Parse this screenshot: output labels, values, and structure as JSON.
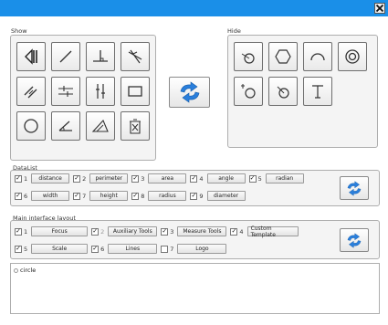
{
  "window": {
    "close_icon": "close-x-icon"
  },
  "show": {
    "label": "Show",
    "tools": [
      {
        "icon": "intersection-point-icon"
      },
      {
        "icon": "line-segment-icon"
      },
      {
        "icon": "perpendicular-icon"
      },
      {
        "icon": "angle-bisector-icon"
      },
      {
        "icon": "parallel-lines-icon"
      },
      {
        "icon": "equal-marks-icon"
      },
      {
        "icon": "vertical-bars-icon"
      },
      {
        "icon": "rectangle-icon"
      },
      {
        "icon": "circle-icon"
      },
      {
        "icon": "angle-icon"
      },
      {
        "icon": "triangle-icon"
      },
      {
        "icon": "delete-icon"
      }
    ]
  },
  "hide": {
    "label": "Hide",
    "tools": [
      {
        "icon": "circle-point-icon"
      },
      {
        "icon": "hexagon-icon"
      },
      {
        "icon": "arc-icon"
      },
      {
        "icon": "concentric-circle-icon"
      },
      {
        "icon": "tangent-circle-icon"
      },
      {
        "icon": "circle-line-icon"
      },
      {
        "icon": "text-icon"
      }
    ]
  },
  "swap_icon": "swap-arrows-icon",
  "datalist": {
    "label": "DataList",
    "items": [
      {
        "num": "1",
        "label": "distance"
      },
      {
        "num": "2",
        "label": "perimeter"
      },
      {
        "num": "3",
        "label": "area"
      },
      {
        "num": "4",
        "label": "angle"
      },
      {
        "num": "5",
        "label": "radian"
      },
      {
        "num": "6",
        "label": "width"
      },
      {
        "num": "7",
        "label": "height"
      },
      {
        "num": "8",
        "label": "radius"
      },
      {
        "num": "9",
        "label": "diameter"
      }
    ]
  },
  "layout": {
    "label": "Main interface layout",
    "items": [
      {
        "num": "1",
        "label": "Focus",
        "checked": true
      },
      {
        "num": "2",
        "label": "Auxiliary Tools",
        "checked": true
      },
      {
        "num": "3",
        "label": "Measure Tools",
        "checked": true
      },
      {
        "num": "4",
        "label": "Custom Template",
        "checked": true
      },
      {
        "num": "5",
        "label": "Scale",
        "checked": true
      },
      {
        "num": "6",
        "label": "Lines",
        "checked": true
      },
      {
        "num": "7",
        "label": "Logo",
        "checked": false
      }
    ]
  },
  "tree": {
    "root": "circle"
  }
}
